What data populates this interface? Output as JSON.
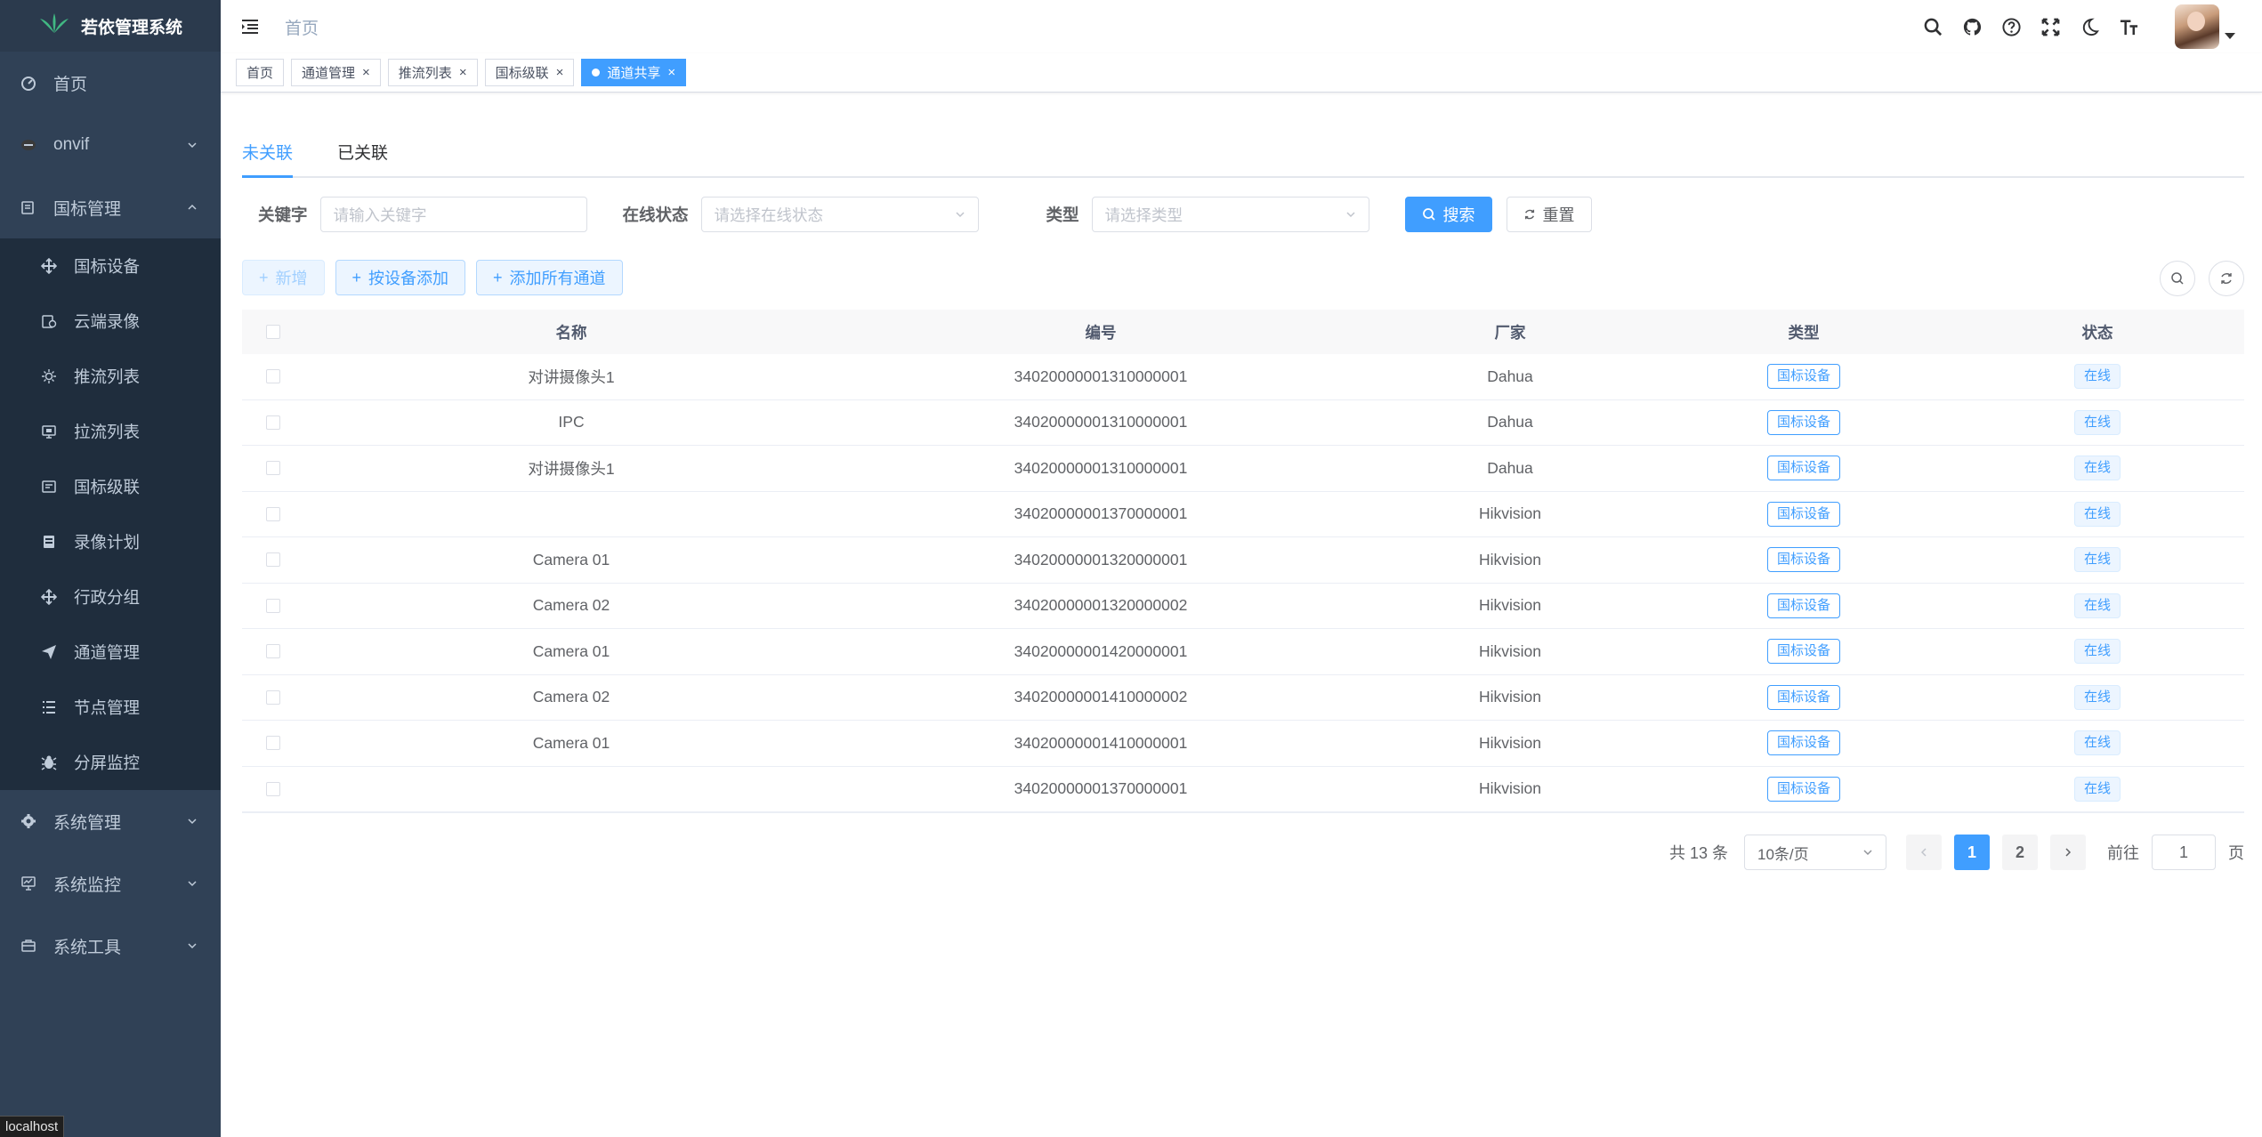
{
  "app": {
    "title": "若依管理系统"
  },
  "sidebar": {
    "items": [
      {
        "label": "首页",
        "icon": "dashboard-icon"
      },
      {
        "label": "onvif",
        "icon": "onvif-icon"
      },
      {
        "label": "国标管理",
        "icon": "gb-manage-icon",
        "expanded": true,
        "children": [
          {
            "label": "国标设备",
            "icon": "device-icon"
          },
          {
            "label": "云端录像",
            "icon": "cloud-record-icon"
          },
          {
            "label": "推流列表",
            "icon": "push-stream-icon"
          },
          {
            "label": "拉流列表",
            "icon": "pull-stream-icon"
          },
          {
            "label": "国标级联",
            "icon": "cascade-icon"
          },
          {
            "label": "录像计划",
            "icon": "record-plan-icon"
          },
          {
            "label": "行政分组",
            "icon": "region-group-icon"
          },
          {
            "label": "通道管理",
            "icon": "channel-icon"
          },
          {
            "label": "节点管理",
            "icon": "node-icon"
          },
          {
            "label": "分屏监控",
            "icon": "split-screen-icon"
          }
        ]
      },
      {
        "label": "系统管理",
        "icon": "gear-icon"
      },
      {
        "label": "系统监控",
        "icon": "monitor-icon"
      },
      {
        "label": "系统工具",
        "icon": "toolbox-icon"
      }
    ]
  },
  "status_bar": {
    "url": "localhost"
  },
  "navbar": {
    "breadcrumb": "首页"
  },
  "tags": [
    {
      "label": "首页",
      "closable": false,
      "active": false
    },
    {
      "label": "通道管理",
      "closable": true,
      "active": false
    },
    {
      "label": "推流列表",
      "closable": true,
      "active": false
    },
    {
      "label": "国标级联",
      "closable": true,
      "active": false
    },
    {
      "label": "通道共享",
      "closable": true,
      "active": true
    }
  ],
  "close_glyph": "×",
  "tabs": [
    {
      "label": "未关联",
      "active": true
    },
    {
      "label": "已关联",
      "active": false
    }
  ],
  "search": {
    "keyword_label": "关键字",
    "keyword_placeholder": "请输入关键字",
    "online_label": "在线状态",
    "online_placeholder": "请选择在线状态",
    "type_label": "类型",
    "type_placeholder": "请选择类型",
    "search_btn": "搜索",
    "reset_btn": "重置"
  },
  "toolbar": {
    "add_btn": "新增",
    "add_by_device_btn": "按设备添加",
    "add_all_btn": "添加所有通道"
  },
  "table": {
    "headers": {
      "name": "名称",
      "code": "编号",
      "vendor": "厂家",
      "type": "类型",
      "status": "状态"
    },
    "rows": [
      {
        "name": "对讲摄像头1",
        "code": "34020000001310000001",
        "vendor": "Dahua",
        "type": "国标设备",
        "status": "在线"
      },
      {
        "name": "IPC",
        "code": "34020000001310000001",
        "vendor": "Dahua",
        "type": "国标设备",
        "status": "在线"
      },
      {
        "name": "对讲摄像头1",
        "code": "34020000001310000001",
        "vendor": "Dahua",
        "type": "国标设备",
        "status": "在线"
      },
      {
        "name": "",
        "code": "34020000001370000001",
        "vendor": "Hikvision",
        "type": "国标设备",
        "status": "在线"
      },
      {
        "name": "Camera 01",
        "code": "34020000001320000001",
        "vendor": "Hikvision",
        "type": "国标设备",
        "status": "在线"
      },
      {
        "name": "Camera 02",
        "code": "34020000001320000002",
        "vendor": "Hikvision",
        "type": "国标设备",
        "status": "在线"
      },
      {
        "name": "Camera 01",
        "code": "34020000001420000001",
        "vendor": "Hikvision",
        "type": "国标设备",
        "status": "在线"
      },
      {
        "name": "Camera 02",
        "code": "34020000001410000002",
        "vendor": "Hikvision",
        "type": "国标设备",
        "status": "在线"
      },
      {
        "name": "Camera 01",
        "code": "34020000001410000001",
        "vendor": "Hikvision",
        "type": "国标设备",
        "status": "在线"
      },
      {
        "name": "",
        "code": "34020000001370000001",
        "vendor": "Hikvision",
        "type": "国标设备",
        "status": "在线"
      }
    ]
  },
  "pagination": {
    "total_text": "共 13 条",
    "page_size": "10条/页",
    "pages": [
      "1",
      "2"
    ],
    "current_page": "1",
    "goto_label": "前往",
    "goto_value": "1",
    "page_suffix": "页"
  },
  "colors": {
    "sidebar_bg": "#304156",
    "submenu_bg": "#1f2d3d",
    "primary": "#409eff",
    "text": "#606266"
  }
}
